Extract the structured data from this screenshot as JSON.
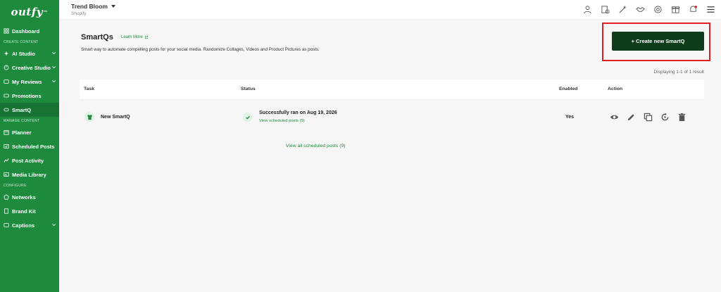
{
  "brand": {
    "logo_text": "outfy",
    "logo_mark": "™"
  },
  "sidebar": {
    "items": [
      {
        "label": "Dashboard",
        "icon": "dashboard-icon"
      },
      {
        "section": "CREATE CONTENT"
      },
      {
        "label": "AI Studio",
        "icon": "ai-icon",
        "expandable": true
      },
      {
        "label": "Creative Studio",
        "icon": "palette-icon",
        "expandable": true
      },
      {
        "label": "My Reviews",
        "icon": "reviews-icon",
        "expandable": true
      },
      {
        "label": "Promotions",
        "icon": "promotions-icon"
      },
      {
        "label": "SmartQ",
        "icon": "smartq-icon",
        "active": true
      },
      {
        "section": "MANAGE CONTENT"
      },
      {
        "label": "Planner",
        "icon": "calendar-icon"
      },
      {
        "label": "Scheduled Posts",
        "icon": "scheduled-icon"
      },
      {
        "label": "Post Activity",
        "icon": "activity-icon"
      },
      {
        "label": "Media Library",
        "icon": "media-icon"
      },
      {
        "section": "CONFIGURE"
      },
      {
        "label": "Networks",
        "icon": "network-icon"
      },
      {
        "label": "Brand Kit",
        "icon": "brandkit-icon"
      },
      {
        "label": "Captions",
        "icon": "captions-icon",
        "expandable": true
      }
    ]
  },
  "topbar": {
    "store_name": "Trend Bloom",
    "store_platform": "Shopify",
    "icons": [
      "user-icon",
      "billing-icon",
      "magic-icon",
      "handshake-icon",
      "support-icon",
      "gift-icon",
      "bell-icon",
      "menu-icon"
    ]
  },
  "page": {
    "title": "SmartQs",
    "learn_more": "Learn More",
    "description": "Smart way to automate compelling posts for your social media. Randomize Collages, Videos and Product Pictures as posts.",
    "create_button": "+ Create new SmartQ",
    "displaying": "Displaying 1-1 of 1 result",
    "view_all": "View all scheduled posts (9)"
  },
  "table": {
    "headers": {
      "task": "Task",
      "status": "Status",
      "enabled": "Enabled",
      "action": "Action"
    },
    "rows": [
      {
        "task": "New SmartQ",
        "status": "Successfully ran on Aug 19, 2026",
        "status_link": "View scheduled posts (9)",
        "enabled": "Yes",
        "actions": [
          "eye-icon",
          "pencil-icon",
          "copy-icon",
          "refresh-icon",
          "trash-icon"
        ]
      }
    ]
  },
  "colors": {
    "sidebar_bg": "#1e8a3e",
    "accent": "#1e8a3e",
    "button_bg": "#0f3d1c",
    "highlight": "#e02020"
  }
}
